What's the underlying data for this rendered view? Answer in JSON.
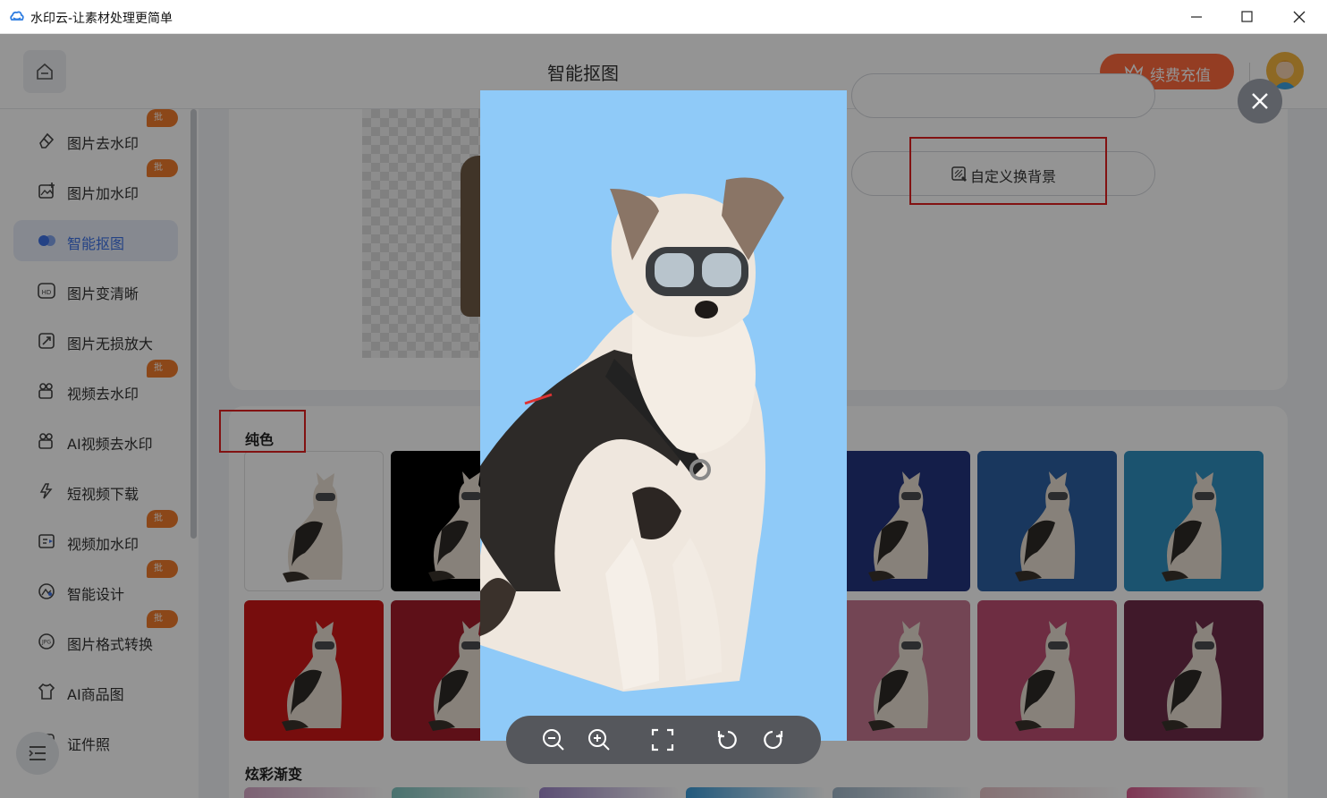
{
  "window": {
    "title": "水印云-让素材处理更简单"
  },
  "header": {
    "page_title": "智能抠图",
    "renew_label": "续费充值"
  },
  "sidebar": {
    "items": [
      {
        "label": "图片去水印",
        "badge": "批量",
        "icon": "eraser-icon"
      },
      {
        "label": "图片加水印",
        "badge": "批量",
        "icon": "image-plus-icon"
      },
      {
        "label": "智能抠图",
        "badge": "",
        "icon": "cutout-icon",
        "active": true
      },
      {
        "label": "图片变清晰",
        "badge": "",
        "icon": "hd-icon"
      },
      {
        "label": "图片无损放大",
        "badge": "",
        "icon": "expand-icon"
      },
      {
        "label": "视频去水印",
        "badge": "批量",
        "icon": "video-eraser-icon"
      },
      {
        "label": "AI视频去水印",
        "badge": "",
        "icon": "ai-video-icon"
      },
      {
        "label": "短视频下载",
        "badge": "",
        "icon": "download-icon"
      },
      {
        "label": "视频加水印",
        "badge": "批量",
        "icon": "video-plus-icon"
      },
      {
        "label": "智能设计",
        "badge": "批量",
        "icon": "design-icon"
      },
      {
        "label": "图片格式转换",
        "badge": "批量",
        "icon": "jpg-icon"
      },
      {
        "label": "AI商品图",
        "badge": "",
        "icon": "shirt-icon"
      },
      {
        "label": "证件照",
        "badge": "",
        "icon": "id-photo-icon"
      }
    ]
  },
  "main": {
    "custom_bg_label": "自定义换背景",
    "solid_section_title": "纯色",
    "gradient_section_title": "炫彩渐变",
    "solid_colors": [
      "#ffffff",
      "#000000",
      "",
      "",
      "#23347f",
      "#2c5fa3",
      "#2f8fc0",
      "#cd1717",
      "#a31c2a",
      "",
      "",
      "#c77891",
      "#bd4f72",
      "#6e2c49"
    ],
    "gradient_colors": [
      "#d7a7c7",
      "#7fc5c0",
      "#9d86c9",
      "#3b9bd8",
      "#9fb6c9",
      "#e6c3c8",
      "#d95b8f"
    ]
  },
  "preview": {
    "background": "#8fcaf8"
  },
  "toolbar": {
    "tools": [
      "zoom-out-icon",
      "zoom-in-icon",
      "fit-screen-icon",
      "rotate-left-icon",
      "rotate-right-icon"
    ]
  }
}
